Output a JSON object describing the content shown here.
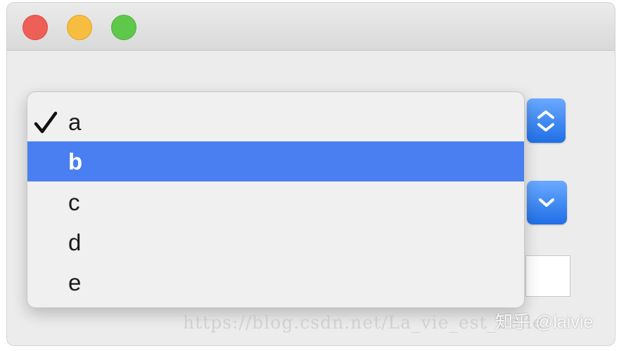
{
  "window": {
    "traffic_lights": [
      "close",
      "minimize",
      "zoom"
    ]
  },
  "popup_menu": {
    "checked_item": "a",
    "highlighted_item": "b",
    "items": [
      {
        "label": "a",
        "checked": true,
        "highlighted": false
      },
      {
        "label": "b",
        "checked": false,
        "highlighted": true
      },
      {
        "label": "c",
        "checked": false,
        "highlighted": false
      },
      {
        "label": "d",
        "checked": false,
        "highlighted": false
      },
      {
        "label": "e",
        "checked": false,
        "highlighted": false
      }
    ]
  },
  "icons": {
    "checkmark": "checkmark-icon",
    "updown": "chevron-up-down-icon",
    "down": "chevron-down-icon"
  },
  "colors": {
    "highlight": "#4a7ff1",
    "accent_button": "#2a78f0",
    "close": "#ee5f57",
    "minimize": "#f7bd3e",
    "zoom": "#5fc84b"
  },
  "watermark": {
    "url": "https://blog.csdn.net/La_vie_est_belle",
    "brand": "知乎 @laivie"
  }
}
